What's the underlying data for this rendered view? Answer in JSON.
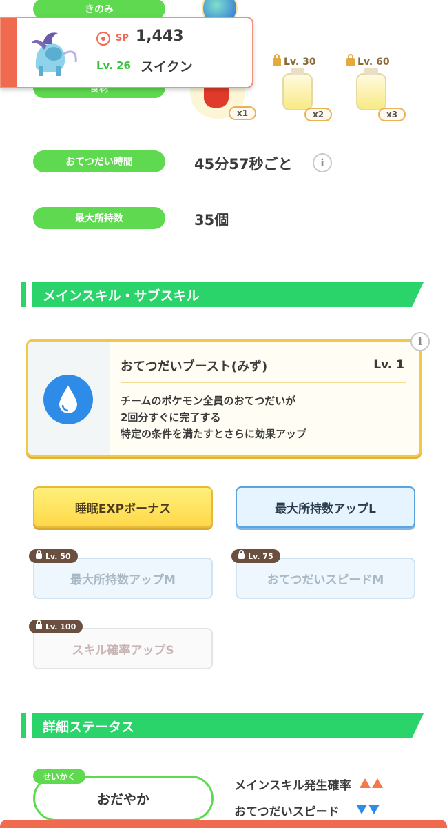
{
  "top": {
    "berry_label": "きのみ",
    "ingredient_label": "食材"
  },
  "pokemon": {
    "sp_label": "SP",
    "sp_value": "1,443",
    "level": "Lv. 26",
    "name": "スイクン"
  },
  "ingredients": [
    {
      "count": "x1"
    },
    {
      "lock_level": "Lv. 30",
      "count": "x2"
    },
    {
      "lock_level": "Lv. 60",
      "count": "x3"
    }
  ],
  "help_time": {
    "label": "おてつだい時間",
    "value": "45分57秒ごと"
  },
  "max_carry": {
    "label": "最大所持数",
    "value": "35個"
  },
  "skills_section": {
    "title": "メインスキル・サブスキル"
  },
  "main_skill": {
    "name": "おてつだいブースト(みず)",
    "level": "Lv. 1",
    "desc1": "チームのポケモン全員のおてつだいが",
    "desc2": "2回分すぐに完了する",
    "desc3": "特定の条件を満たすとさらに効果アップ"
  },
  "sub_skills": [
    {
      "label": "睡眠EXPボーナス"
    },
    {
      "label": "最大所持数アップL"
    },
    {
      "label": "最大所持数アップM",
      "lock": "Lv. 50"
    },
    {
      "label": "おてつだいスピードM",
      "lock": "Lv. 75"
    },
    {
      "label": "スキル確率アップS",
      "lock": "Lv. 100"
    }
  ],
  "status_section": {
    "title": "詳細ステータス"
  },
  "nature": {
    "tag": "せいかく",
    "value": "おだやか"
  },
  "stats": [
    {
      "label": "メインスキル発生確率",
      "direction": "up"
    },
    {
      "label": "おてつだいスピード",
      "direction": "down"
    }
  ],
  "colors": {
    "accent_green": "#5fd94f",
    "section_green": "#2bd46a",
    "card_accent": "#f06a4f",
    "water_blue": "#2f8be8"
  }
}
